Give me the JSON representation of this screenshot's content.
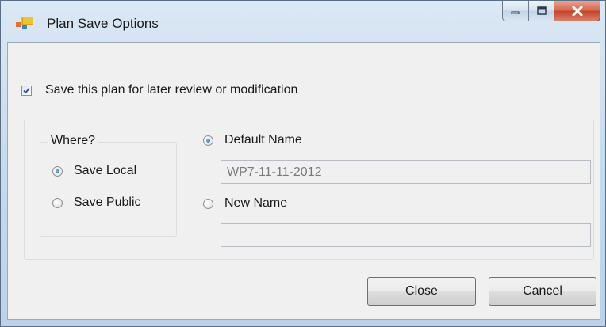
{
  "window": {
    "title": "Plan Save Options",
    "icon": "app-icon",
    "controls": {
      "minimize": "minimize-icon",
      "maximize": "maximize-icon",
      "close": "close-icon"
    }
  },
  "save_checkbox": {
    "label": "Save this plan for later review or modification",
    "checked": true
  },
  "where_group": {
    "legend": "Where?",
    "options": [
      {
        "label": "Save Local",
        "selected": true
      },
      {
        "label": "Save Public",
        "selected": false
      }
    ]
  },
  "name_options": {
    "default": {
      "label": "Default Name",
      "selected": true,
      "value": "WP7-11-11-2012"
    },
    "new": {
      "label": "New Name",
      "selected": false,
      "value": ""
    }
  },
  "buttons": {
    "close": "Close",
    "cancel": "Cancel"
  },
  "colors": {
    "accent": "#1b5fa8",
    "close_button": "#c4452a"
  }
}
